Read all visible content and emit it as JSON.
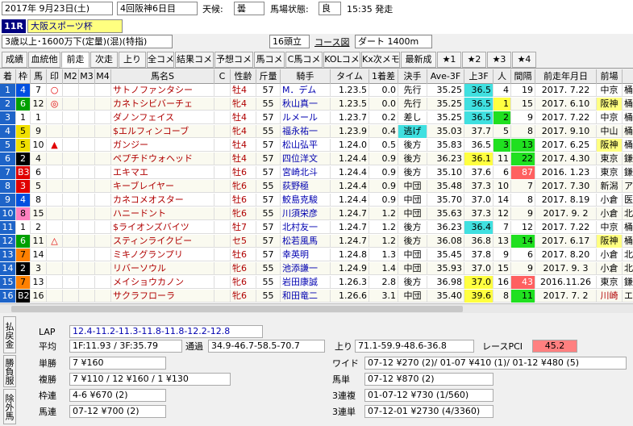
{
  "header": {
    "date": "2017年 9月23日(土)",
    "meeting": "4回阪神6日目",
    "weather_label": "天候:",
    "weather": "曇",
    "track_label": "馬場状態:",
    "track": "良",
    "start_time": "15:35 発走",
    "race_no": "11R",
    "race_name": "大阪スポーツ杯",
    "condition": "3歳以上･1600万下(定量)(混)(特指)",
    "runners": "16頭立",
    "course_btn": "コース図",
    "course": "ダート 1400m"
  },
  "tabs": [
    "成績",
    "血統他",
    "前走",
    "次走",
    "上り",
    "全コメ",
    "結果コメ",
    "予想コメ",
    "馬コメ",
    "C馬コメ",
    "KOLコメ",
    "Kx次メモ",
    "最新成",
    "★1",
    "★2",
    "★3",
    "★4"
  ],
  "active_tab": 2,
  "columns": [
    "着",
    "枠",
    "馬",
    "印",
    "M2",
    "M3",
    "M4",
    "馬名S",
    "C",
    "性齢",
    "斤量",
    "騎手",
    "タイム",
    "1着差",
    "決手",
    "Ave-3F",
    "上3F",
    "人",
    "間隔",
    "前走年月日",
    "前場"
  ],
  "rows": [
    {
      "pos": "1",
      "waku": "4",
      "uma": "7",
      "mark": "○",
      "name": "サトノファンタシー",
      "sex": "牡4",
      "kin": "57",
      "jockey": "M．デム",
      "time": "1.23.5",
      "diff": "0.0",
      "kime": "先行",
      "ave": "35.25",
      "agari": "36.5",
      "pop": "4",
      "kan": "19",
      "date": "2017. 7.22",
      "place": "中京",
      "extra": "桶"
    },
    {
      "pos": "2",
      "waku": "6",
      "uma": "12",
      "mark": "◎",
      "name": "カネトシビバーチェ",
      "sex": "牝4",
      "kin": "55",
      "jockey": "秋山真一",
      "time": "1.23.5",
      "diff": "0.0",
      "kime": "先行",
      "ave": "35.25",
      "agari": "36.5",
      "pop": "1",
      "kan": "15",
      "date": "2017. 6.10",
      "place": "阪神",
      "extra": "桶"
    },
    {
      "pos": "3",
      "waku": "1",
      "uma": "1",
      "mark": "",
      "name": "ダノンフェイス",
      "sex": "牡4",
      "kin": "57",
      "jockey": "ルメール",
      "time": "1.23.7",
      "diff": "0.2",
      "kime": "差し",
      "ave": "35.25",
      "agari": "36.5",
      "pop": "2",
      "kan": "9",
      "date": "2017. 7.22",
      "place": "中京",
      "extra": "桶"
    },
    {
      "pos": "4",
      "waku": "5",
      "uma": "9",
      "mark": "",
      "name": "$エルフィンコーブ",
      "sex": "牝4",
      "kin": "55",
      "jockey": "福永祐一",
      "time": "1.23.9",
      "diff": "0.4",
      "kime": "逃げ",
      "ave": "35.03",
      "agari": "37.7",
      "pop": "5",
      "kan": "8",
      "date": "2017. 9.10",
      "place": "中山",
      "extra": "桶"
    },
    {
      "pos": "5",
      "waku": "5",
      "uma": "10",
      "mark": "▲",
      "name": "ガンジー",
      "sex": "牡4",
      "kin": "57",
      "jockey": "松山弘平",
      "time": "1.24.0",
      "diff": "0.5",
      "kime": "後方",
      "ave": "35.83",
      "agari": "36.5",
      "pop": "3",
      "kan": "13",
      "date": "2017. 6.25",
      "place": "阪神",
      "extra": "桶"
    },
    {
      "pos": "6",
      "waku": "2",
      "uma": "4",
      "mark": "",
      "name": "ペプチドウォヘッド",
      "sex": "牡4",
      "kin": "57",
      "jockey": "四位洋文",
      "time": "1.24.4",
      "diff": "0.9",
      "kime": "後方",
      "ave": "36.23",
      "agari": "36.1",
      "pop": "11",
      "kan": "22",
      "date": "2017. 4.30",
      "place": "東京",
      "extra": "鎌"
    },
    {
      "pos": "7",
      "waku": "B3",
      "uma": "6",
      "mark": "",
      "name": "エキマエ",
      "sex": "牡6",
      "kin": "57",
      "jockey": "宮崎北斗",
      "time": "1.24.4",
      "diff": "0.9",
      "kime": "後方",
      "ave": "35.10",
      "agari": "37.6",
      "pop": "6",
      "kan": "87",
      "date": "2016. 1.23",
      "place": "東京",
      "extra": "鎌"
    },
    {
      "pos": "8",
      "waku": "3",
      "uma": "5",
      "mark": "",
      "name": "キーブレイヤー",
      "sex": "牝6",
      "kin": "55",
      "jockey": "荻野極",
      "time": "1.24.4",
      "diff": "0.9",
      "kime": "中団",
      "ave": "35.48",
      "agari": "37.3",
      "pop": "10",
      "kan": "7",
      "date": "2017. 7.30",
      "place": "新潟",
      "extra": "ア"
    },
    {
      "pos": "9",
      "waku": "4",
      "uma": "8",
      "mark": "",
      "name": "カネコメオスター",
      "sex": "牡6",
      "kin": "57",
      "jockey": "鮫島克駿",
      "time": "1.24.4",
      "diff": "0.9",
      "kime": "中団",
      "ave": "35.70",
      "agari": "37.0",
      "pop": "14",
      "kan": "8",
      "date": "2017. 8.19",
      "place": "小倉",
      "extra": "医"
    },
    {
      "pos": "10",
      "waku": "8",
      "uma": "15",
      "mark": "",
      "name": "ハニードント",
      "sex": "牝6",
      "kin": "55",
      "jockey": "川須栄彦",
      "time": "1.24.7",
      "diff": "1.2",
      "kime": "中団",
      "ave": "35.63",
      "agari": "37.3",
      "pop": "12",
      "kan": "9",
      "date": "2017. 9. 2",
      "place": "小倉",
      "extra": "北"
    },
    {
      "pos": "11",
      "waku": "1",
      "uma": "2",
      "mark": "",
      "name": "$ライオンズバイツ",
      "sex": "牡7",
      "kin": "57",
      "jockey": "北村友一",
      "time": "1.24.7",
      "diff": "1.2",
      "kime": "後方",
      "ave": "36.23",
      "agari": "36.4",
      "pop": "7",
      "kan": "12",
      "date": "2017. 7.22",
      "place": "中京",
      "extra": "桶"
    },
    {
      "pos": "12",
      "waku": "6",
      "uma": "11",
      "mark": "△",
      "name": "スティンライクビー",
      "sex": "セ5",
      "kin": "57",
      "jockey": "松若風馬",
      "time": "1.24.7",
      "diff": "1.2",
      "kime": "後方",
      "ave": "36.08",
      "agari": "36.8",
      "pop": "13",
      "kan": "14",
      "date": "2017. 6.17",
      "place": "阪神",
      "extra": "桶"
    },
    {
      "pos": "13",
      "waku": "7",
      "uma": "14",
      "mark": "",
      "name": "ミキノグランプリ",
      "sex": "牡6",
      "kin": "57",
      "jockey": "幸英明",
      "time": "1.24.8",
      "diff": "1.3",
      "kime": "中団",
      "ave": "35.45",
      "agari": "37.8",
      "pop": "9",
      "kan": "6",
      "date": "2017. 8.20",
      "place": "小倉",
      "extra": "北"
    },
    {
      "pos": "14",
      "waku": "2",
      "uma": "3",
      "mark": "",
      "name": "リバーソウル",
      "sex": "牝6",
      "kin": "55",
      "jockey": "池添謙一",
      "time": "1.24.9",
      "diff": "1.4",
      "kime": "中団",
      "ave": "35.93",
      "agari": "37.0",
      "pop": "15",
      "kan": "9",
      "date": "2017. 9. 3",
      "place": "小倉",
      "extra": "北"
    },
    {
      "pos": "15",
      "waku": "7",
      "uma": "13",
      "mark": "",
      "name": "メイショウカノン",
      "sex": "牝6",
      "kin": "55",
      "jockey": "岩田康誠",
      "time": "1.26.3",
      "diff": "2.8",
      "kime": "後方",
      "ave": "36.98",
      "agari": "37.0",
      "pop": "16",
      "kan": "43",
      "date": "2016.11.26",
      "place": "東京",
      "extra": "鎌"
    },
    {
      "pos": "16",
      "waku": "B2",
      "uma": "16",
      "mark": "",
      "name": "サクラフローラ",
      "sex": "牝6",
      "kin": "55",
      "jockey": "和田竜二",
      "time": "1.26.6",
      "diff": "3.1",
      "kime": "中団",
      "ave": "35.40",
      "agari": "39.6",
      "pop": "8",
      "kan": "11",
      "date": "2017. 7. 2",
      "place": "川崎",
      "extra": "エ"
    }
  ],
  "bottom": {
    "side_tabs": [
      "払戻金",
      "勝負服",
      "除外馬"
    ],
    "lap_label": "LAP",
    "lap": "12.4-11.2-11.3-11.8-11.8-12.2-12.8",
    "avg_label": "平均",
    "avg": "1F:11.93 / 3F:35.79",
    "pass_label": "通過",
    "pass": "34.9-46.7-58.5-70.7",
    "agari_label": "上り",
    "agari": "71.1-59.9-48.6-36.8",
    "pci_label": "レースPCI",
    "pci": "45.2",
    "payouts": [
      {
        "label": "単勝",
        "value": "7 ¥160"
      },
      {
        "label": "複勝",
        "value": "7 ¥110 / 12 ¥160 / 1 ¥130"
      },
      {
        "label": "枠連",
        "value": "4-6 ¥670 (2)"
      },
      {
        "label": "馬連",
        "value": "07-12 ¥700 (2)"
      }
    ],
    "payouts_right": [
      {
        "label": "ワイド",
        "value": "07-12 ¥270 (2)/ 01-07 ¥410 (1)/ 01-12 ¥480 (5)"
      },
      {
        "label": "馬単",
        "value": "07-12 ¥870 (2)"
      },
      {
        "label": "3連複",
        "value": "01-07-12 ¥730 (1/560)"
      },
      {
        "label": "3連単",
        "value": "07-12-01 ¥2730 (4/3360)"
      }
    ]
  },
  "colors": {
    "waku": {
      "1": "#ffffff",
      "2": "#000000",
      "3": "#e00000",
      "4": "#0050e0",
      "5": "#f0e000",
      "6": "#00a000",
      "7": "#ff8000",
      "8": "#ff80c0"
    },
    "rowno_bg": "#1e64c8",
    "highlight_cyan": "#40e0e0",
    "highlight_yellow": "#ffff40",
    "highlight_green": "#20e020",
    "highlight_red": "#ff6060",
    "pci_bg": "#ff8080"
  }
}
